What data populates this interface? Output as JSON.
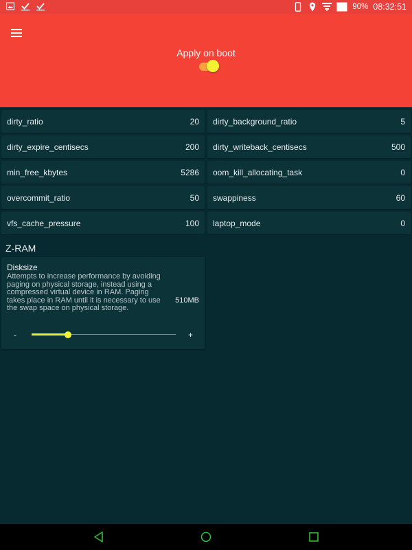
{
  "status_bar": {
    "left_icons": [
      "image-icon",
      "check-icon",
      "check-icon"
    ],
    "battery_percent": "90%",
    "time": "08:32:51"
  },
  "header": {
    "apply_on_boot_label": "Apply on boot",
    "apply_on_boot_on": true
  },
  "settings": [
    {
      "name": "dirty_ratio",
      "value": "20"
    },
    {
      "name": "dirty_background_ratio",
      "value": "5"
    },
    {
      "name": "dirty_expire_centisecs",
      "value": "200"
    },
    {
      "name": "dirty_writeback_centisecs",
      "value": "500"
    },
    {
      "name": "min_free_kbytes",
      "value": "5286"
    },
    {
      "name": "oom_kill_allocating_task",
      "value": "0"
    },
    {
      "name": "overcommit_ratio",
      "value": "50"
    },
    {
      "name": "swappiness",
      "value": "60"
    },
    {
      "name": "vfs_cache_pressure",
      "value": "100"
    },
    {
      "name": "laptop_mode",
      "value": "0"
    }
  ],
  "zram": {
    "section_title": "Z-RAM",
    "disksize_title": "Disksize",
    "description": "Attempts to increase performance by avoiding paging on physical storage, instead using a compressed virtual device in RAM. Paging takes place in RAM until it is necessary to use the swap space on physical storage.",
    "value": "510MB",
    "slider_fraction": 0.25,
    "minus_label": "-",
    "plus_label": "+"
  },
  "colors": {
    "header": "#f44336",
    "background": "#062a30",
    "card": "#0b3338",
    "accent": "#f2f233",
    "nav_icons": "#2fbf2f"
  }
}
